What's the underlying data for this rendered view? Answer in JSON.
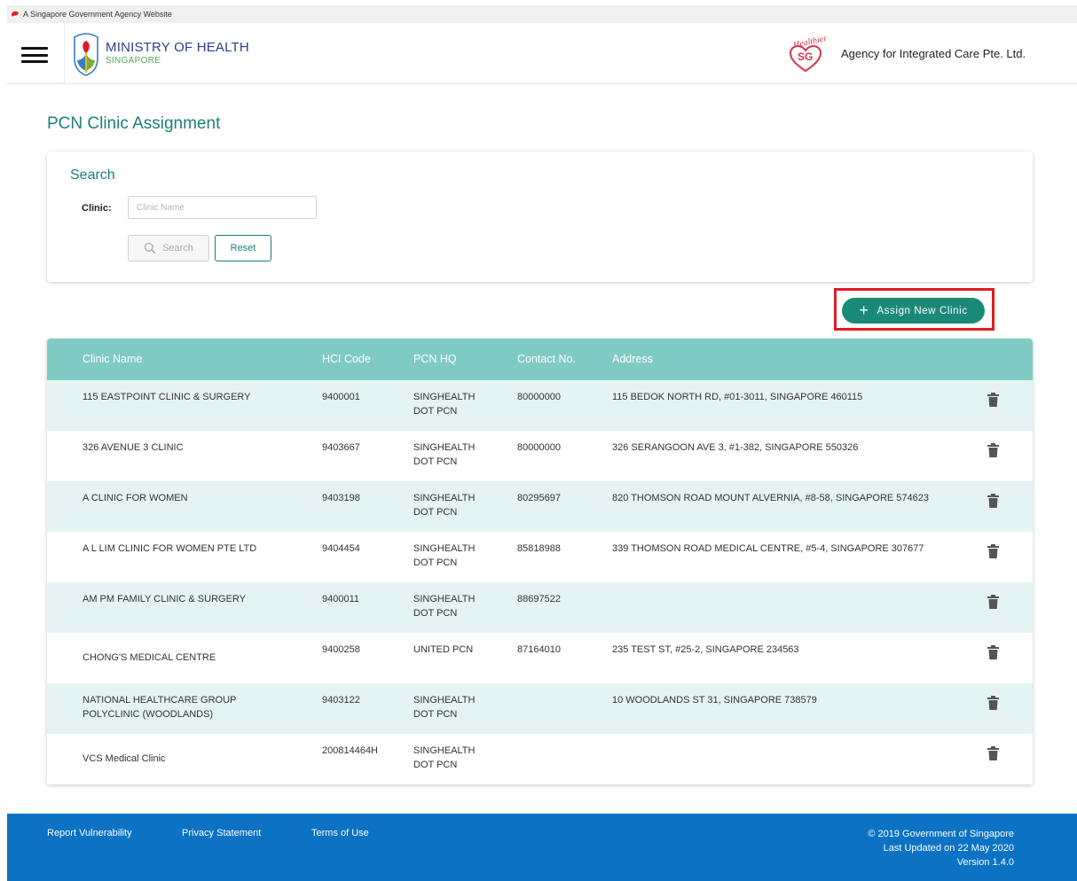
{
  "gov_banner": {
    "text": "A Singapore Government Agency Website",
    "icon": "lion-head-icon"
  },
  "header": {
    "ministry_title": "MINISTRY OF HEALTH",
    "ministry_sub": "SINGAPORE",
    "healthier_logo_text": "Healthier",
    "healthier_logo_sg": "SG",
    "agency": "Agency for Integrated Care Pte. Ltd."
  },
  "page": {
    "title": "PCN Clinic Assignment"
  },
  "search": {
    "title": "Search",
    "clinic_label": "Clinic:",
    "clinic_value": "",
    "clinic_placeholder": "Clinic Name",
    "search_button": "Search",
    "reset_button": "Reset"
  },
  "assign_button": "Assign New Clinic",
  "table": {
    "columns": [
      "Clinic Name",
      "HCI Code",
      "PCN HQ",
      "Contact No.",
      "Address"
    ],
    "rows": [
      {
        "name": "115 EASTPOINT CLINIC & SURGERY",
        "hci": "9400001",
        "pcn1": "SINGHEALTH",
        "pcn2": "DOT PCN",
        "contact": "80000000",
        "address": "115 BEDOK NORTH RD, #01-3011, SINGAPORE 460115"
      },
      {
        "name": "326 AVENUE 3 CLINIC",
        "hci": "9403667",
        "pcn1": "SINGHEALTH",
        "pcn2": "DOT PCN",
        "contact": "80000000",
        "address": "326 SERANGOON AVE 3, #1-382, SINGAPORE 550326"
      },
      {
        "name": "A CLINIC FOR WOMEN",
        "hci": "9403198",
        "pcn1": "SINGHEALTH",
        "pcn2": "DOT PCN",
        "contact": "80295697",
        "address": "820 THOMSON ROAD MOUNT ALVERNIA, #8-58, SINGAPORE 574623"
      },
      {
        "name": "A L LIM CLINIC FOR WOMEN PTE LTD",
        "hci": "9404454",
        "pcn1": "SINGHEALTH",
        "pcn2": "DOT PCN",
        "contact": "85818988",
        "address": "339 THOMSON ROAD MEDICAL CENTRE, #5-4, SINGAPORE 307677"
      },
      {
        "name": "AM PM FAMILY CLINIC & SURGERY",
        "hci": "9400011",
        "pcn1": "SINGHEALTH",
        "pcn2": "DOT PCN",
        "contact": "88697522",
        "address": ""
      },
      {
        "name": "CHONG'S MEDICAL CENTRE",
        "hci": "9400258",
        "pcn1": "UNITED PCN",
        "pcn2": "",
        "contact": "87164010",
        "address": "235 TEST ST, #25-2, SINGAPORE 234563"
      },
      {
        "name": "NATIONAL HEALTHCARE GROUP",
        "name2": "POLYCLINIC (WOODLANDS)",
        "hci": "9403122",
        "pcn1": "SINGHEALTH",
        "pcn2": "DOT PCN",
        "contact": "",
        "address": "10 WOODLANDS ST 31, SINGAPORE 738579"
      },
      {
        "name": "VCS Medical Clinic",
        "hci": "200814464H",
        "pcn1": "SINGHEALTH",
        "pcn2": "DOT PCN",
        "contact": "",
        "address": ""
      }
    ]
  },
  "footer": {
    "links": [
      "Report Vulnerability",
      "Privacy Statement",
      "Terms of Use"
    ],
    "copyright": "© 2019 Government of Singapore",
    "updated": "Last Updated on 22 May 2020",
    "version": "Version 1.4.0"
  },
  "colors": {
    "teal": "#1a7f7a",
    "table_header": "#7fcbc3",
    "row_shade": "#e4f4f2",
    "footer": "#0b72c4",
    "highlight": "#e31b23"
  }
}
